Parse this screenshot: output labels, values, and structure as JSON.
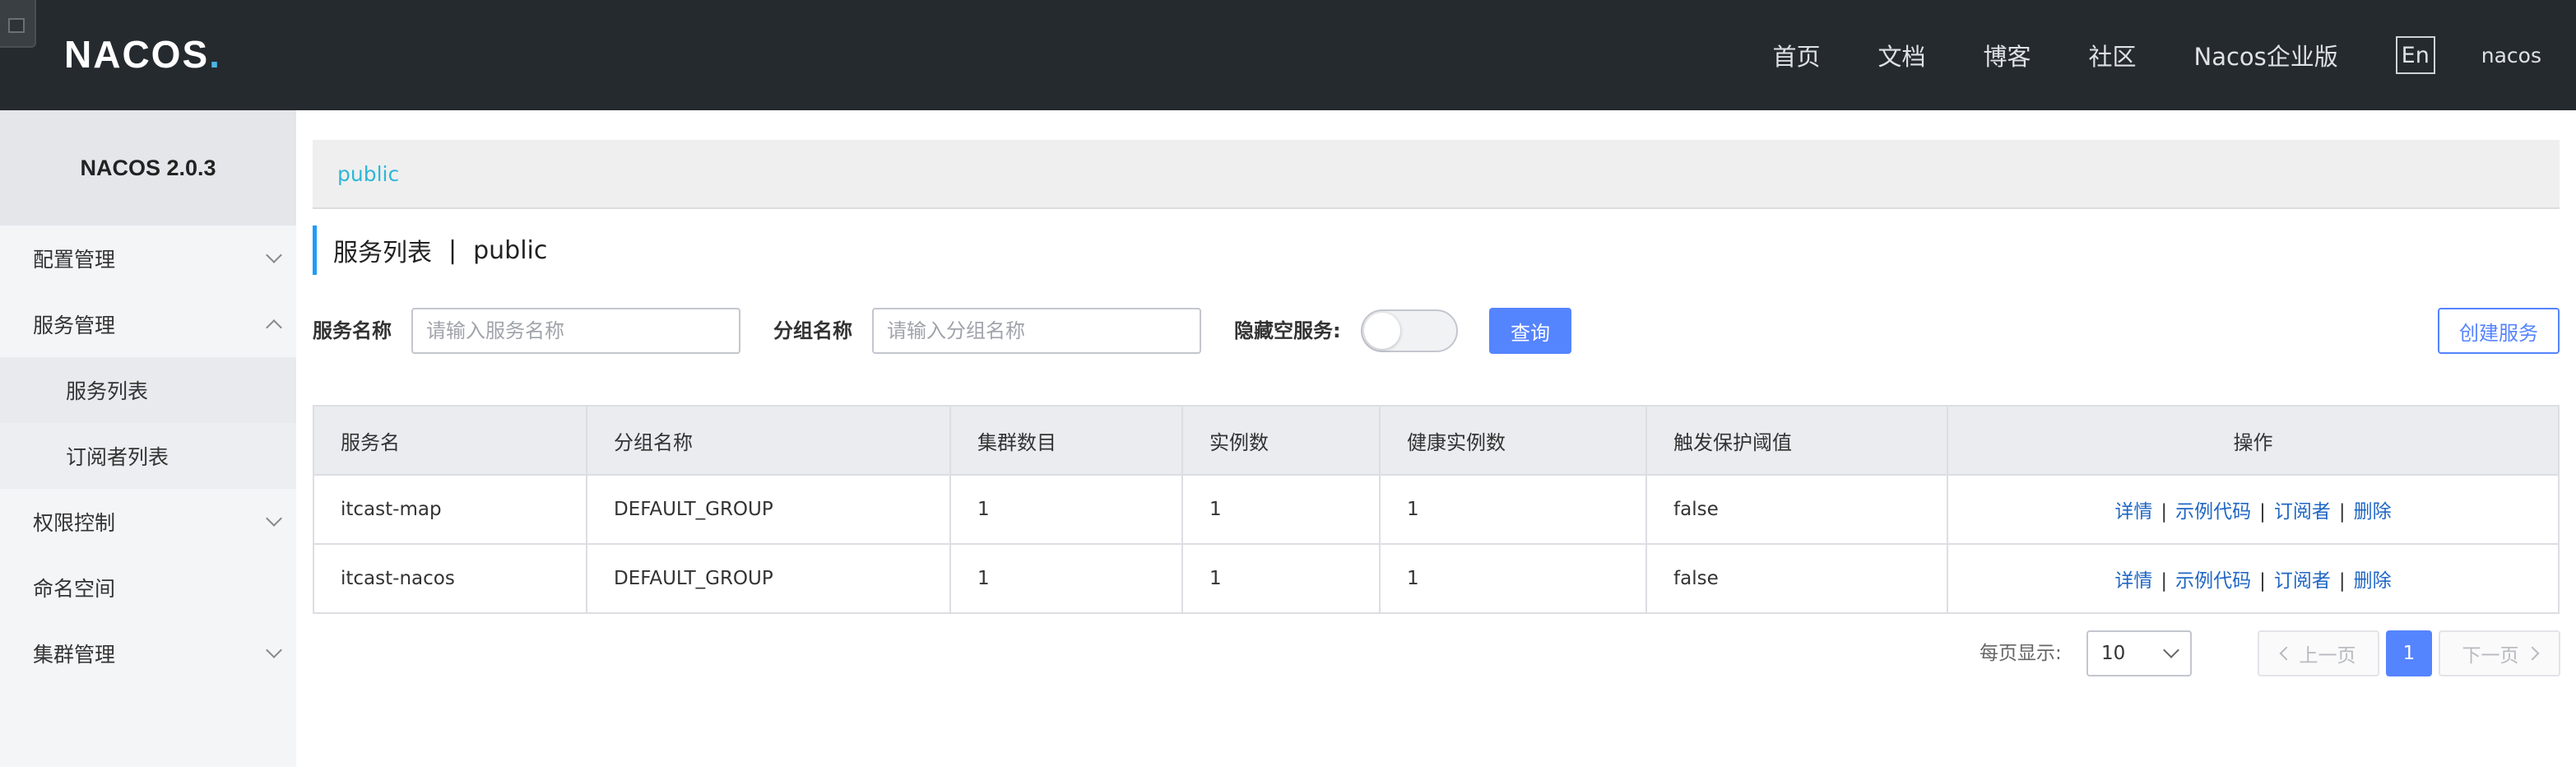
{
  "header": {
    "logo_text": "NACOS",
    "logo_dot": ".",
    "nav": [
      "首页",
      "文档",
      "博客",
      "社区",
      "Nacos企业版"
    ],
    "lang_button": "En",
    "user": "nacos"
  },
  "sidebar": {
    "version": "NACOS 2.0.3",
    "items": [
      {
        "label": "配置管理",
        "expanded": false
      },
      {
        "label": "服务管理",
        "expanded": true
      },
      {
        "label": "服务列表",
        "sub": true
      },
      {
        "label": "订阅者列表",
        "sub": true
      },
      {
        "label": "权限控制",
        "expanded": false
      },
      {
        "label": "命名空间"
      },
      {
        "label": "集群管理",
        "expanded": false
      }
    ]
  },
  "namespace_bar": {
    "current": "public"
  },
  "page_title": {
    "title": "服务列表",
    "separator": "|",
    "namespace": "public"
  },
  "filters": {
    "service_name_label": "服务名称",
    "service_name_placeholder": "请输入服务名称",
    "group_name_label": "分组名称",
    "group_name_placeholder": "请输入分组名称",
    "hide_empty_label": "隐藏空服务:",
    "hide_empty_enabled": false,
    "query_button": "查询",
    "create_button": "创建服务"
  },
  "table": {
    "columns": [
      "服务名",
      "分组名称",
      "集群数目",
      "实例数",
      "健康实例数",
      "触发保护阈值",
      "操作"
    ],
    "rows": [
      {
        "name": "itcast-map",
        "group": "DEFAULT_GROUP",
        "clusters": "1",
        "instances": "1",
        "healthy": "1",
        "protect": "false"
      },
      {
        "name": "itcast-nacos",
        "group": "DEFAULT_GROUP",
        "clusters": "1",
        "instances": "1",
        "healthy": "1",
        "protect": "false"
      }
    ],
    "actions": {
      "detail": "详情",
      "sample": "示例代码",
      "subscriber": "订阅者",
      "delete": "删除",
      "separator": "|"
    }
  },
  "pagination": {
    "per_page_label": "每页显示:",
    "per_page_value": "10",
    "prev": "上一页",
    "current": "1",
    "next": "下一页"
  },
  "colors": {
    "header_bg": "#252a2f",
    "primary": "#5584ff",
    "link": "#2067c5",
    "accent": "#209bfa"
  }
}
